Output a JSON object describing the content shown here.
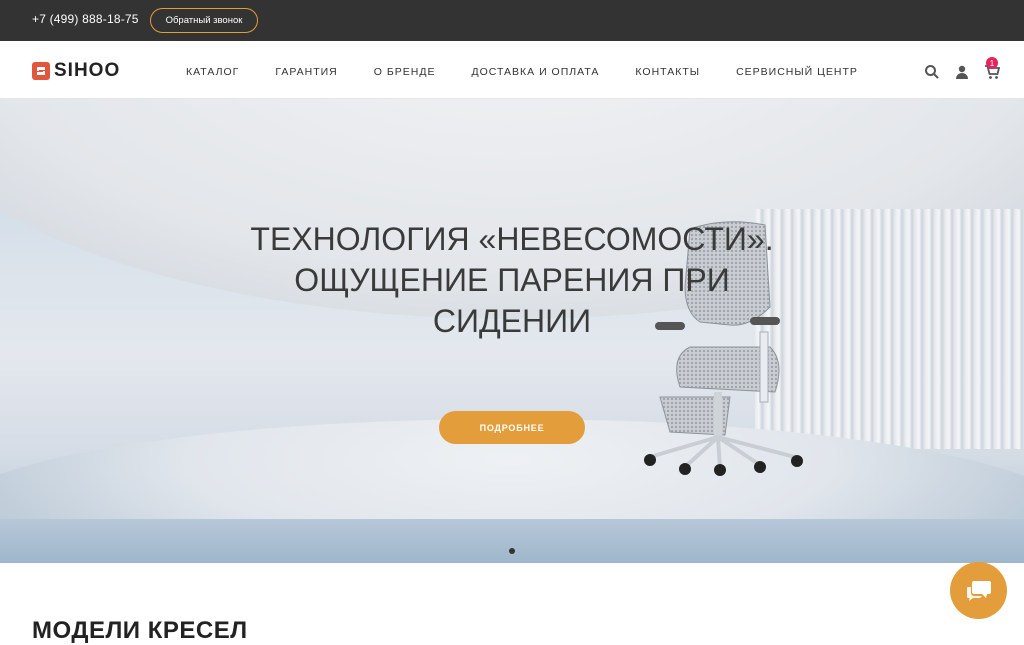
{
  "topbar": {
    "phone": "+7 (499) 888-18-75",
    "callback_label": "Обратный звонок"
  },
  "header": {
    "logo_text": "SIHOO",
    "nav": [
      {
        "label": "КАТАЛОГ"
      },
      {
        "label": "ГАРАНТИЯ"
      },
      {
        "label": "О БРЕНДЕ"
      },
      {
        "label": "ДОСТАВКА И ОПЛАТА"
      },
      {
        "label": "КОНТАКТЫ"
      },
      {
        "label": "СЕРВИСНЫЙ ЦЕНТР"
      }
    ],
    "icons": [
      "search-icon",
      "user-icon",
      "cart-icon"
    ],
    "cart_count": "1"
  },
  "hero": {
    "title": "ТЕХНОЛОГИЯ «НЕВЕСОМОСТИ». ОЩУЩЕНИЕ ПАРЕНИЯ ПРИ СИДЕНИИ",
    "button_label": "ПОДРОБНЕЕ"
  },
  "section": {
    "title": "МОДЕЛИ КРЕСЕЛ"
  },
  "colors": {
    "accent": "#e39d3a",
    "topbar": "#333333",
    "badge": "#e2245f",
    "logo": "#e1573c"
  }
}
